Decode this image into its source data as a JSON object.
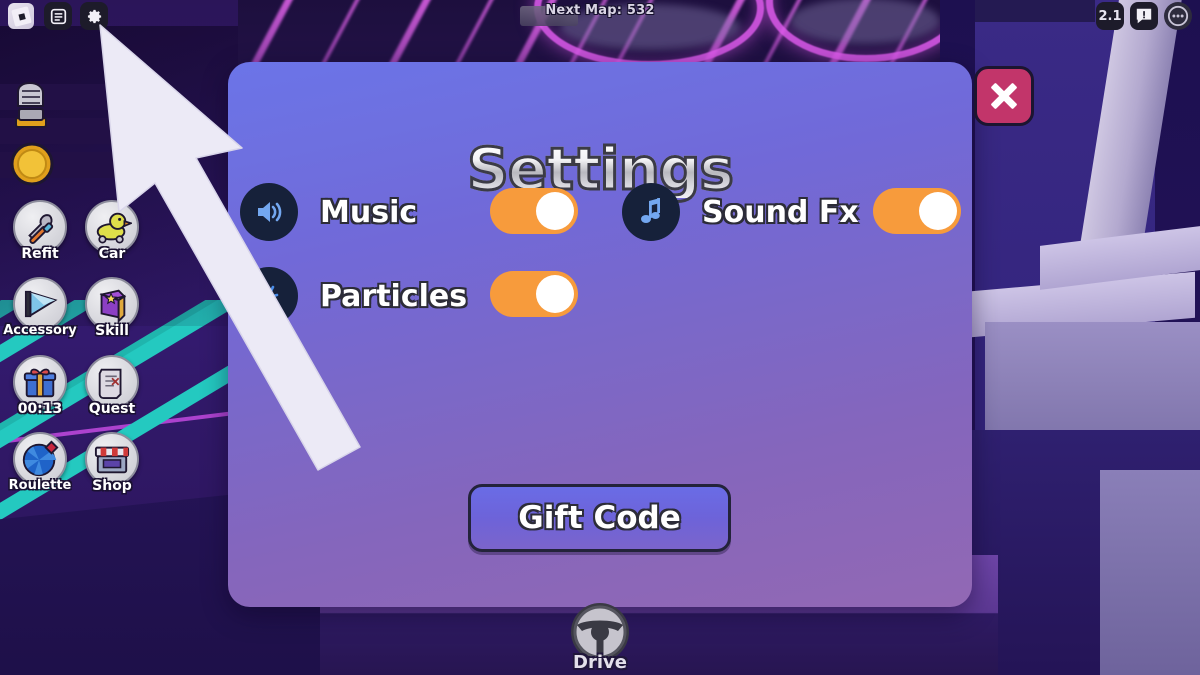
{
  "topbar": {
    "roblox_icon": "roblox-logo-icon",
    "menu_icon": "menu-list-icon",
    "settings_icon": "gear-icon",
    "next_map_text": "Next Map: 532",
    "fps_value": "2.1",
    "chat_icon": "chat-alert-icon",
    "more_icon": "more-options-icon"
  },
  "sidebar": {
    "stat_icons": [
      {
        "name": "strength-fist-icon",
        "label": ""
      },
      {
        "name": "coin-icon",
        "label": ""
      }
    ],
    "buttons": [
      {
        "label": "Refit",
        "icon": "wrench-screwdriver-icon"
      },
      {
        "label": "Car",
        "icon": "rubber-duck-icon"
      },
      {
        "label": "Accessory",
        "icon": "wing-cone-icon"
      },
      {
        "label": "Skill",
        "icon": "skill-book-icon"
      },
      {
        "label": "00:13",
        "icon": "gift-box-icon"
      },
      {
        "label": "Quest",
        "icon": "quest-scroll-icon"
      },
      {
        "label": "Roulette",
        "icon": "roulette-wheel-icon"
      },
      {
        "label": "Shop",
        "icon": "shop-store-icon"
      }
    ]
  },
  "settings_panel": {
    "title": "Settings",
    "close_label": "close-button",
    "rows": [
      {
        "label": "Music",
        "icon": "speaker-icon",
        "toggle_state": "on"
      },
      {
        "label": "Sound Fx",
        "icon": "music-note-icon",
        "toggle_state": "on"
      },
      {
        "label": "Particles",
        "icon": "particles-icon",
        "toggle_state": "on"
      }
    ],
    "gift_code_label": "Gift Code"
  },
  "bottom": {
    "drive_label": "Drive",
    "drive_icon": "steering-wheel-icon"
  },
  "colors": {
    "panel_top": "#6b74e8",
    "panel_bottom": "#9268b4",
    "toggle_on": "#f79b3c",
    "close_red": "#c2356a",
    "icon_navy": "#16213a",
    "neon_magenta": "#e25cf0",
    "track_teal": "#24c9c0"
  }
}
